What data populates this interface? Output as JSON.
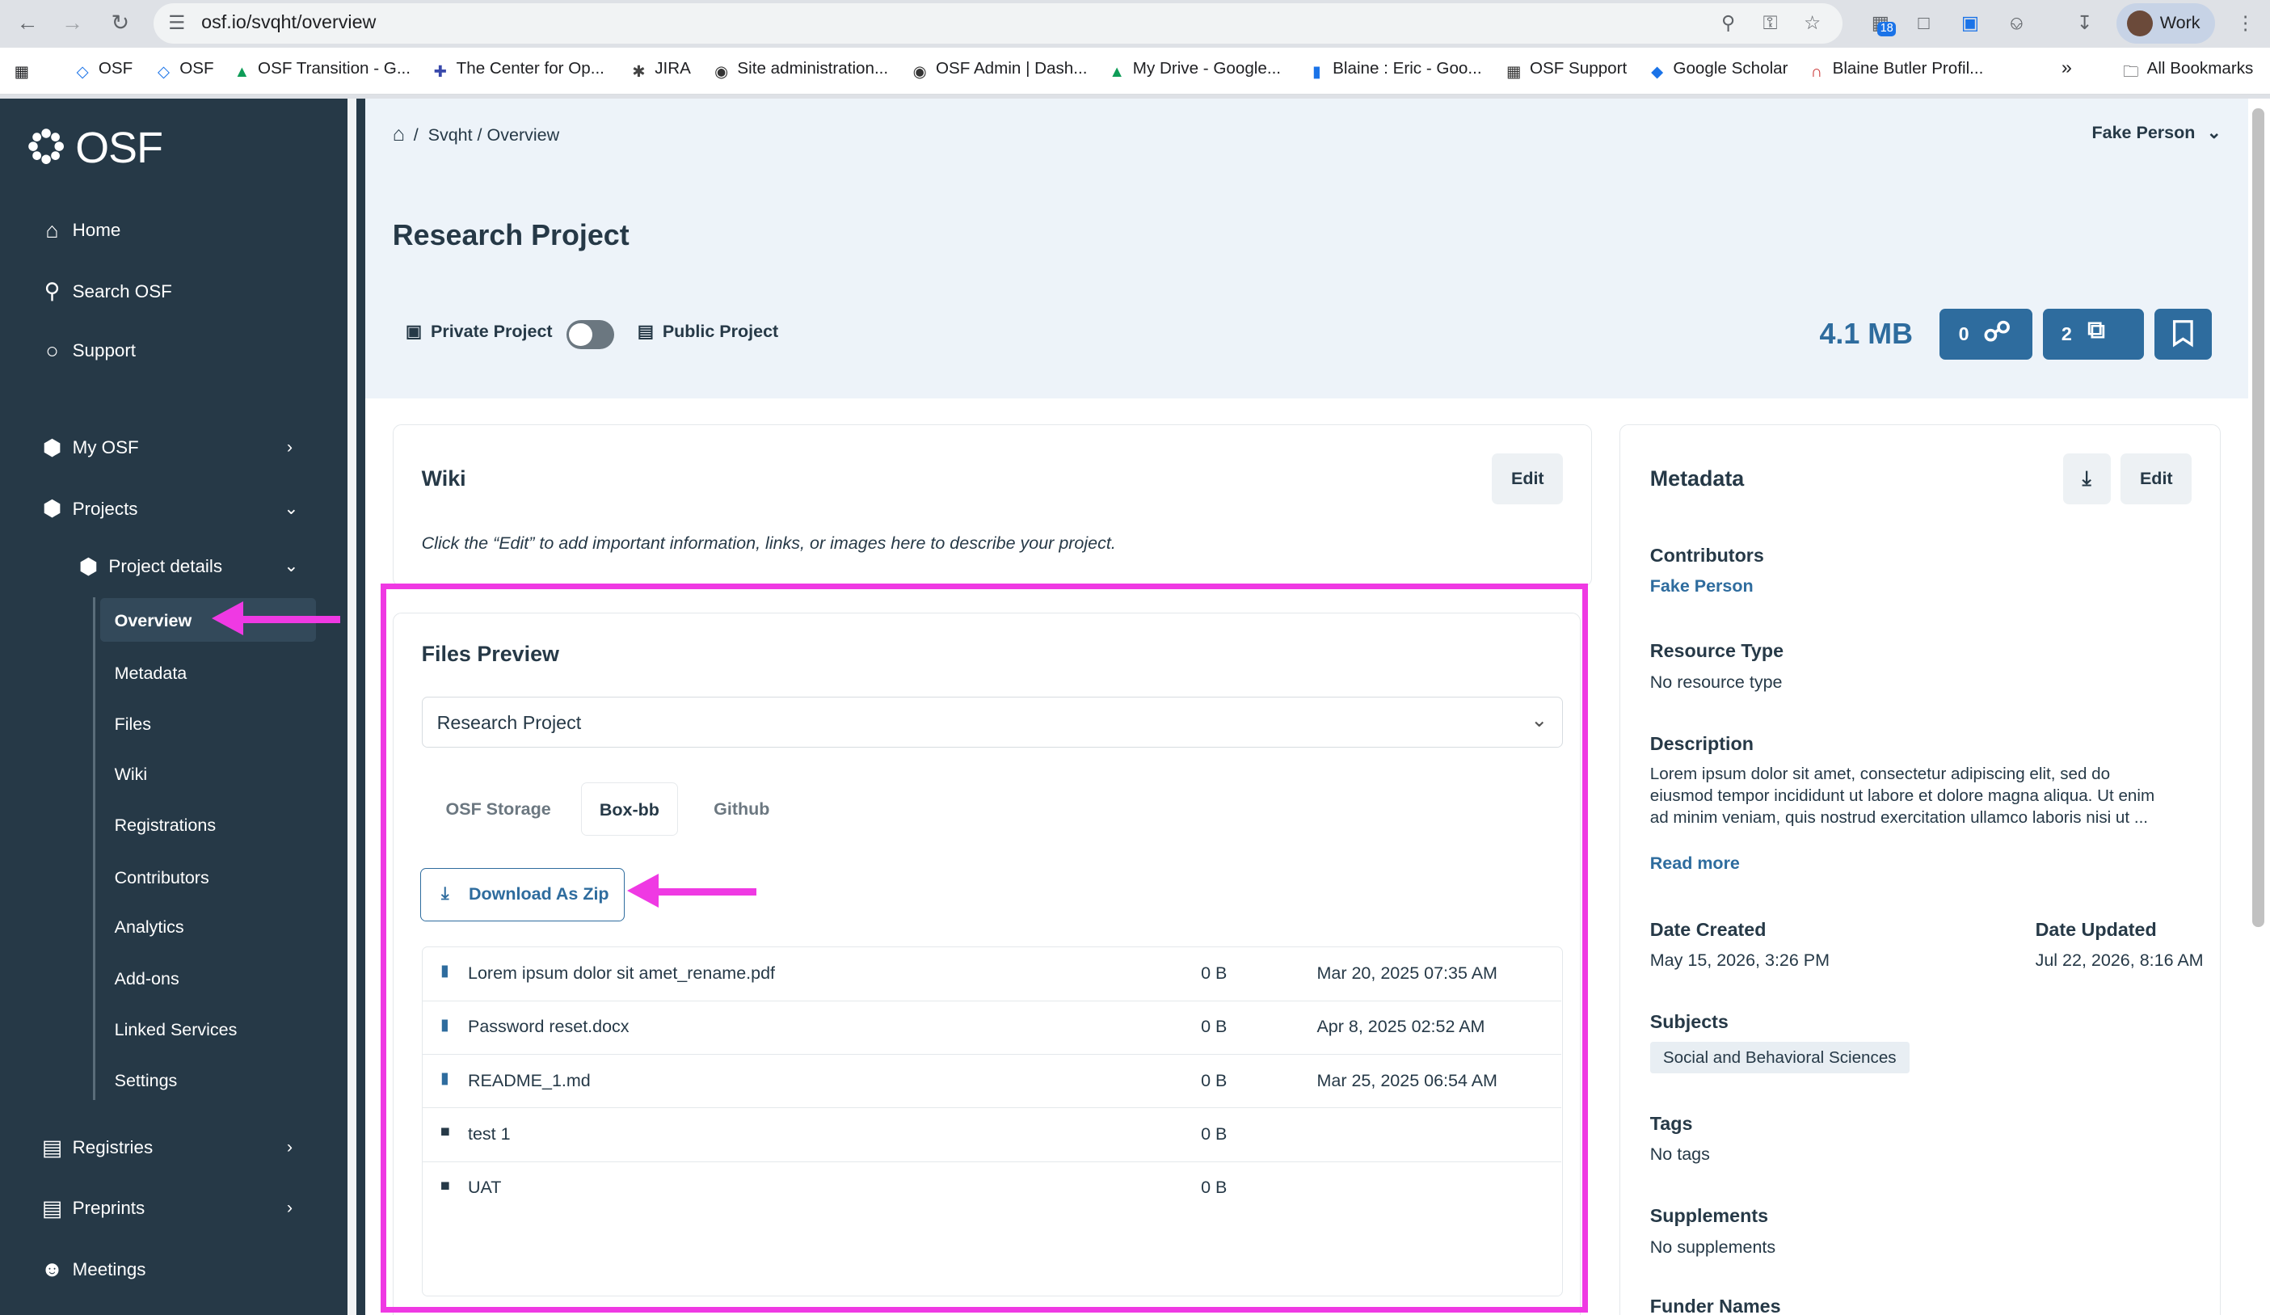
{
  "browser": {
    "url": "osf.io/svqht/overview",
    "profile_label": "Work",
    "ext_badge": "18",
    "bookmarks": [
      "OSF",
      "OSF",
      "OSF Transition - G...",
      "The Center for Op...",
      "JIRA",
      "Site administration...",
      "OSF Admin | Dash...",
      "My Drive - Google...",
      "Blaine : Eric - Goo...",
      "OSF Support",
      "Google Scholar",
      "Blaine Butler Profil..."
    ],
    "bookmarks_overflow": "»",
    "all_bookmarks": "All Bookmarks"
  },
  "sidebar": {
    "logo_text": "OSF",
    "home": "Home",
    "search": "Search OSF",
    "support": "Support",
    "my_osf": "My OSF",
    "projects": "Projects",
    "project_details": "Project details",
    "sub_items": [
      "Overview",
      "Metadata",
      "Files",
      "Wiki",
      "Registrations",
      "Contributors",
      "Analytics",
      "Add-ons",
      "Linked Services",
      "Settings"
    ],
    "registries": "Registries",
    "preprints": "Preprints",
    "meetings": "Meetings"
  },
  "header": {
    "breadcrumb": "Svqht / Overview",
    "user_name": "Fake Person",
    "project_title": "Research Project",
    "private_label": "Private Project",
    "public_label": "Public Project",
    "project_is_public": false,
    "storage_size": "4.1 MB",
    "links_count": "0",
    "forks_count": "2"
  },
  "wiki": {
    "title": "Wiki",
    "edit_label": "Edit",
    "hint": "Click the “Edit” to add important information, links, or images here to describe your project."
  },
  "files_preview": {
    "title": "Files Preview",
    "selected_project": "Research Project",
    "tabs": [
      "OSF Storage",
      "Box-bb",
      "Github"
    ],
    "active_tab": "Box-bb",
    "download_label": "Download As Zip",
    "files": [
      {
        "name": "Lorem ipsum dolor sit amet_rename.pdf",
        "size": "0 B",
        "date": "Mar 20, 2025 07:35 AM",
        "type": "file"
      },
      {
        "name": "Password reset.docx",
        "size": "0 B",
        "date": "Apr 8, 2025 02:52 AM",
        "type": "file"
      },
      {
        "name": "README_1.md",
        "size": "0 B",
        "date": "Mar 25, 2025 06:54 AM",
        "type": "file"
      },
      {
        "name": "test 1",
        "size": "0 B",
        "date": "",
        "type": "folder"
      },
      {
        "name": "UAT",
        "size": "0 B",
        "date": "",
        "type": "folder"
      }
    ]
  },
  "metadata": {
    "title": "Metadata",
    "edit_label": "Edit",
    "contributors_label": "Contributors",
    "contributor": "Fake Person",
    "resource_type_label": "Resource Type",
    "resource_type": "No resource type",
    "description_label": "Description",
    "description": [
      "Lorem ipsum dolor sit amet, consectetur adipiscing elit, sed do",
      "eiusmod tempor incididunt ut labore et dolore magna aliqua. Ut enim",
      "ad minim veniam, quis nostrud exercitation ullamco laboris nisi ut ..."
    ],
    "read_more": "Read more",
    "date_created_label": "Date Created",
    "date_created": "May 15, 2026, 3:26 PM",
    "date_updated_label": "Date Updated",
    "date_updated": "Jul 22, 2026, 8:16 AM",
    "subjects_label": "Subjects",
    "subject": "Social and Behavioral Sciences",
    "tags_label": "Tags",
    "tags": "No tags",
    "supplements_label": "Supplements",
    "supplements": "No supplements",
    "funder_label": "Funder Names"
  },
  "colors": {
    "sidebar_bg": "#263947",
    "accent": "#2e6c9e",
    "hero_bg": "#edf3f9",
    "annotation": "#ef39e3"
  }
}
